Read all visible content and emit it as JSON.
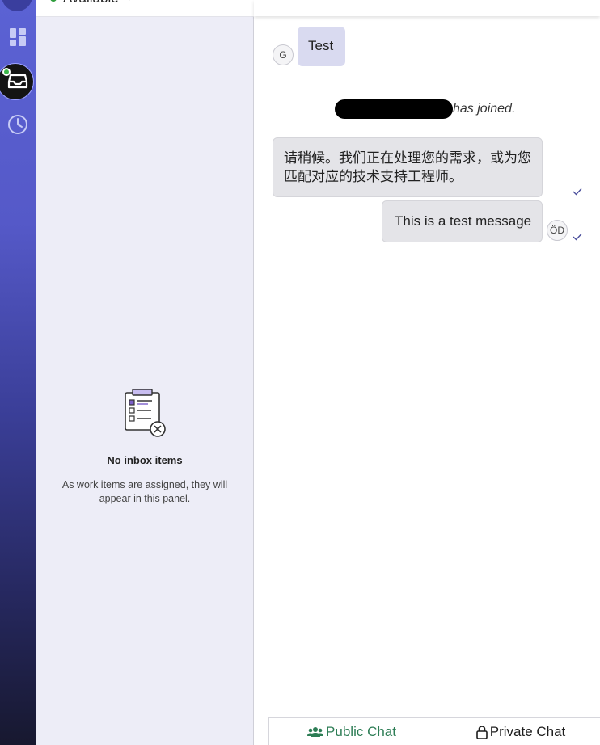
{
  "status": {
    "label": "Available"
  },
  "inbox": {
    "empty_title": "No inbox items",
    "empty_desc": "As work items are assigned, they will appear in this panel."
  },
  "messages": [
    {
      "avatar": "G",
      "text": "Test"
    },
    {
      "system": "has joined."
    },
    {
      "text": "请稍候。我们正在处理您的需求，或为您匹配对应的技术支持工程师。"
    },
    {
      "avatar": "ÖD",
      "text": "This is a test message"
    }
  ],
  "tabs": {
    "public": "Public Chat",
    "private": "Private Chat"
  },
  "icons": {
    "rail": [
      "dashboard-icon",
      "inbox-icon",
      "history-clock-icon"
    ],
    "tabs": [
      "people-icon",
      "lock-icon"
    ],
    "empty": "clipboard-list-icon"
  },
  "colors": {
    "rail_top": "#5b62d4",
    "rail_bottom": "#17182f",
    "agent_bubble": "#d9daf0",
    "grey_bubble": "#e4e4e8",
    "public_tab": "#2d7d55",
    "available": "#2e9d3c"
  }
}
